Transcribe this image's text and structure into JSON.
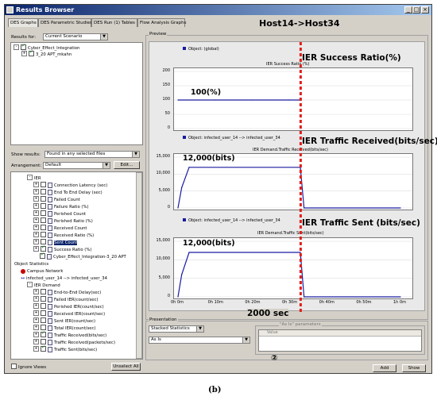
{
  "window": {
    "title": "Results Browser"
  },
  "tabs": [
    "DES Graphs",
    "DES Parametric Studies",
    "DES Run (1) Tables",
    "Flow Analysis Graphs"
  ],
  "left": {
    "results_for_label": "Results for:",
    "results_for_value": "Current Scenario",
    "scenario_tree": [
      "Cyber_Effect_Integration",
      "3_20 APT_mkahn"
    ],
    "show_results_label": "Show results:",
    "show_results_value": "Found in any selected files",
    "arrangement_label": "Arrangement:",
    "arrangement_value": "Default",
    "edit_button": "Edit...",
    "stat_tree": [
      "IER",
      "Connection Latency (sec)",
      "End To End Delay (sec)",
      "Failed Count",
      "Failure Ratio (%)",
      "Perished Count",
      "Perished Ratio (%)",
      "Received Count",
      "Received Ratio (%)",
      "Sent Count",
      "Success Ratio (%)",
      "Cyber_Effect_Integration-3_20 APT",
      "Object Statistics",
      "Campus Network",
      "infected_user_14 --> infected_user_34",
      "IER Demand",
      "End-to-End Delay(sec)",
      "Failed IER(count/sec)",
      "Perished IER(count/sec)",
      "Received IER(count/sec)",
      "Sent IER(count/sec)",
      "Total IER(count/sec)",
      "Traffic Received(bits/sec)",
      "Traffic Received(packets/sec)",
      "Traffic Sent(bits/sec)"
    ],
    "ignore_views": "Ignore Views",
    "unselect_all": "Unselect All"
  },
  "preview": {
    "label": "Preview",
    "header_annotation": "Host14->Host34",
    "charts": [
      {
        "object": "Object: (global)",
        "title": "IER Success Ratio (%)",
        "annotation": "IER Success Ratio(%)",
        "value_label": "100(%)",
        "yticks": [
          "200",
          "150",
          "100",
          "50",
          "0"
        ]
      },
      {
        "object": "Object: infected_user_14 --> infected_user_34",
        "title": "IER Demand.Traffic Received(bits/sec)",
        "annotation": "IER Traffic Received(bits/sec)",
        "value_label": "12,000(bits)",
        "yticks": [
          "15,000",
          "10,000",
          "5,000",
          "0"
        ]
      },
      {
        "object": "Object: infected_user_14 --> infected_user_34",
        "title": "IER Demand.Traffic Sent(bits/sec)",
        "annotation": "IER Traffic Sent (bits/sec)",
        "value_label": "12,000(bits)",
        "yticks": [
          "15,000",
          "10,000",
          "5,000",
          "0"
        ]
      }
    ],
    "xticks": [
      "0h 0m",
      "0h 10m",
      "0h 20m",
      "0h 30m",
      "0h 40m",
      "0h 50m",
      "1h 0m"
    ],
    "time_marker": "2000 sec"
  },
  "presentation": {
    "label": "Presentation",
    "mode": "Stacked Statistics",
    "value": "As Is",
    "params_label": "\"As Is\" parameters",
    "params_col": "Value",
    "marker": "②",
    "add_button": "Add",
    "show_button": "Show"
  },
  "caption": "(b)",
  "chart_data": [
    {
      "type": "line",
      "title": "IER Success Ratio (%)",
      "ylim": [
        0,
        200
      ],
      "x": [
        "0h 0m",
        "0h 10m",
        "0h 20m",
        "0h 30m",
        "0h 33m"
      ],
      "series": [
        {
          "values": [
            100,
            100,
            100,
            100,
            100
          ]
        }
      ]
    },
    {
      "type": "line",
      "title": "IER Demand.Traffic Received(bits/sec)",
      "ylim": [
        0,
        15000
      ],
      "x": [
        "0h 0m",
        "0h 1m",
        "0h 3m",
        "0h 33m",
        "0h 34m",
        "1h 0m"
      ],
      "series": [
        {
          "values": [
            0,
            6000,
            12000,
            12000,
            0,
            0
          ]
        }
      ]
    },
    {
      "type": "line",
      "title": "IER Demand.Traffic Sent(bits/sec)",
      "ylim": [
        0,
        15000
      ],
      "x": [
        "0h 0m",
        "0h 1m",
        "0h 3m",
        "0h 33m",
        "0h 34m",
        "1h 0m"
      ],
      "series": [
        {
          "values": [
            0,
            6000,
            12000,
            12000,
            0,
            0
          ]
        }
      ]
    }
  ],
  "colors": {
    "series": "#1a1aa0",
    "marker": "#e0201c",
    "titlebar": "#0a246a"
  }
}
